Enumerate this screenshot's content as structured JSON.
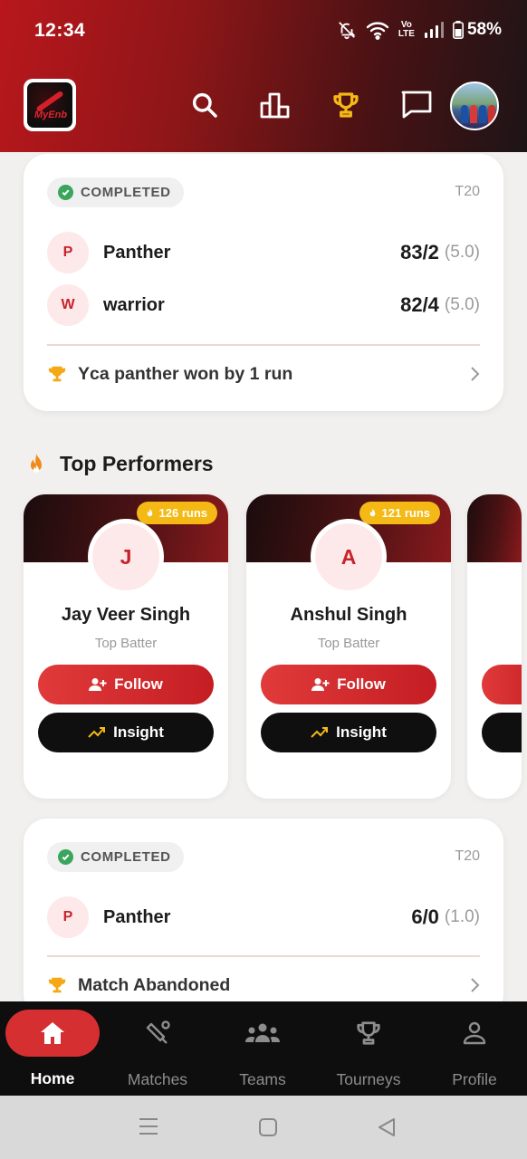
{
  "status_bar": {
    "time": "12:34",
    "volte_top": "Vo",
    "volte_bottom": "LTE",
    "battery": "58%"
  },
  "header": {
    "logo_text": "MyEnb",
    "icons": [
      "search-icon",
      "leaderboard-icon",
      "trophy-icon",
      "chat-icon"
    ],
    "accent_color": "#f5b915"
  },
  "match_1": {
    "status": "COMPLETED",
    "format": "T20",
    "teams": [
      {
        "initial": "P",
        "name": "Panther",
        "score": "83/2",
        "overs": "(5.0)"
      },
      {
        "initial": "W",
        "name": "warrior",
        "score": "82/4",
        "overs": "(5.0)"
      }
    ],
    "result": "Yca panther won by 1 run"
  },
  "top_performers": {
    "title": "Top Performers",
    "players": [
      {
        "initial": "J",
        "name": "Jay Veer Singh",
        "role": "Top Batter",
        "runs": "126 runs",
        "follow": "Follow",
        "insight": "Insight"
      },
      {
        "initial": "A",
        "name": "Anshul Singh",
        "role": "Top Batter",
        "runs": "121 runs",
        "follow": "Follow",
        "insight": "Insight"
      }
    ]
  },
  "match_2": {
    "status": "COMPLETED",
    "format": "T20",
    "teams": [
      {
        "initial": "P",
        "name": "Panther",
        "score": "6/0",
        "overs": "(1.0)"
      }
    ],
    "result": "Match Abandoned"
  },
  "bottom_nav": [
    {
      "label": "Home",
      "icon": "home-icon",
      "active": true
    },
    {
      "label": "Matches",
      "icon": "cricket-bat-icon"
    },
    {
      "label": "Teams",
      "icon": "teams-icon"
    },
    {
      "label": "Tourneys",
      "icon": "trophy-icon"
    },
    {
      "label": "Profile",
      "icon": "person-icon"
    }
  ],
  "colors": {
    "brand_red": "#d62f31",
    "header_dark": "#1d1416",
    "completed_green": "#3aa55c"
  }
}
